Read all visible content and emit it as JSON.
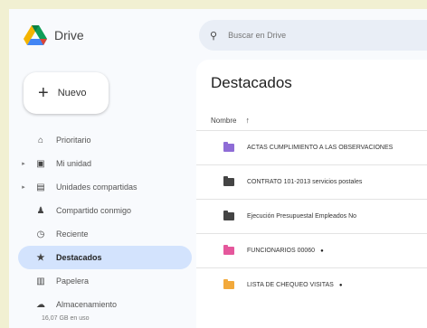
{
  "app": {
    "name": "Drive"
  },
  "new_button": {
    "label": "Nuevo"
  },
  "search": {
    "placeholder": "Buscar en Drive"
  },
  "sidebar": {
    "items": [
      {
        "label": "Prioritario",
        "icon": "home-icon",
        "glyph": "⌂",
        "caret": ""
      },
      {
        "label": "Mi unidad",
        "icon": "drive-icon",
        "glyph": "▣",
        "caret": "▸"
      },
      {
        "label": "Unidades compartidas",
        "icon": "shared-drives-icon",
        "glyph": "▤",
        "caret": "▸"
      },
      {
        "label": "Compartido conmigo",
        "icon": "people-icon",
        "glyph": "♟",
        "caret": ""
      },
      {
        "label": "Reciente",
        "icon": "clock-icon",
        "glyph": "◷",
        "caret": ""
      },
      {
        "label": "Destacados",
        "icon": "star-icon",
        "glyph": "★",
        "caret": "",
        "active": true
      },
      {
        "label": "Papelera",
        "icon": "trash-icon",
        "glyph": "▥",
        "caret": ""
      },
      {
        "label": "Almacenamiento",
        "icon": "cloud-icon",
        "glyph": "☁",
        "caret": ""
      }
    ],
    "storage_text": "16,07 GB en uso"
  },
  "main": {
    "title": "Destacados",
    "column_name": "Nombre",
    "files": [
      {
        "name": "ACTAS CUMPLIMIENTO A LAS OBSERVACIONES",
        "color": "#8e6cd6",
        "badge": ""
      },
      {
        "name": "CONTRATO 101-2013 servicios postales",
        "color": "#444444",
        "badge": ""
      },
      {
        "name": "Ejecución Presupuestal Empleados No",
        "color": "#444444",
        "badge": ""
      },
      {
        "name": "FUNCIONARIOS 00060",
        "color": "#e5579c",
        "badge": "●"
      },
      {
        "name": "LISTA DE CHEQUEO VISITAS",
        "color": "#f2a93b",
        "badge": "●"
      }
    ]
  },
  "colors": {
    "accent": "#d3e3fd",
    "search_bg": "#e9eef6"
  }
}
